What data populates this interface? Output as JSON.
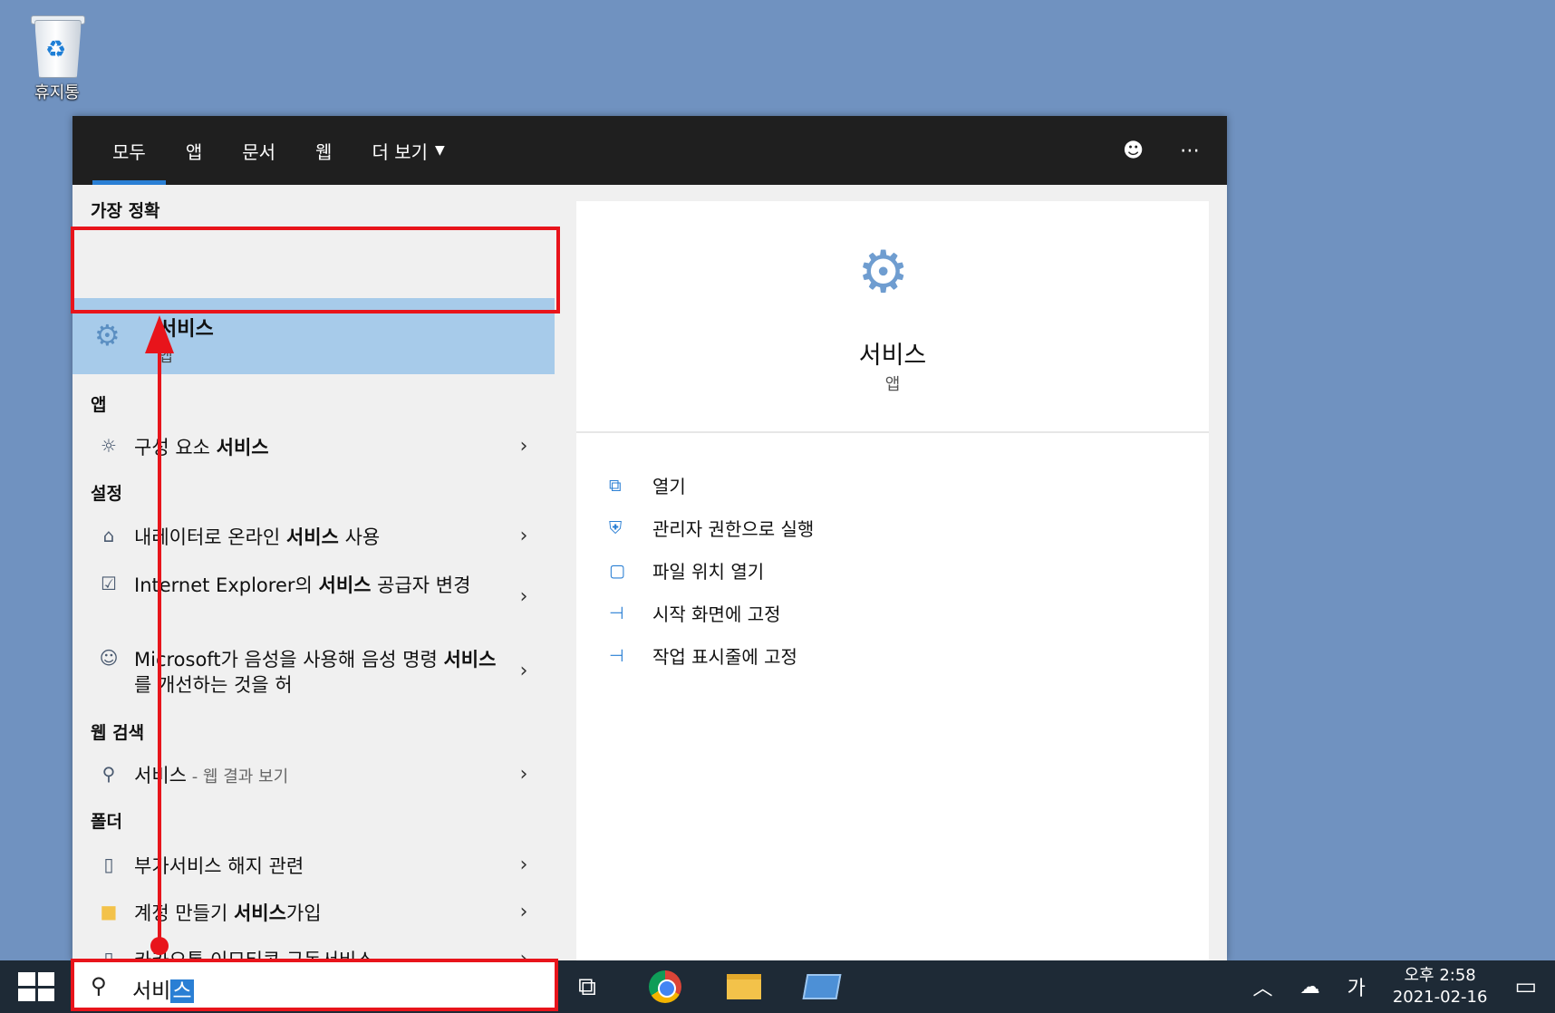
{
  "desktop": {
    "recycle_bin_label": "휴지통"
  },
  "search": {
    "tabs": [
      {
        "label": "모두",
        "active": true
      },
      {
        "label": "앱"
      },
      {
        "label": "문서"
      },
      {
        "label": "웹"
      },
      {
        "label": "더 보기"
      }
    ],
    "sections": {
      "best_match": "가장 정확",
      "apps": "앱",
      "settings": "설정",
      "web": "웹 검색",
      "folders": "폴더"
    },
    "best_match": {
      "title": "서비스",
      "subtitle": "앱"
    },
    "results": {
      "component_services": {
        "pre": "구성 요소 ",
        "bold": "서비스",
        "post": ""
      },
      "narrator": {
        "pre": "내레이터로 온라인 ",
        "bold": "서비스",
        "post": " 사용"
      },
      "ie": {
        "pre": "Internet Explorer의 ",
        "bold": "서비스",
        "post": " 공급자 변경"
      },
      "microsoft_voice": {
        "pre": "Microsoft가 음성을 사용해 음성 명령 ",
        "bold": "서비스",
        "post": "를 개선하는 것을 허"
      },
      "web_search": {
        "pre": "서비스",
        "muted": " - 웹 결과 보기"
      },
      "folder_1": {
        "pre": "부가서비스 해지 관련",
        "bold": "",
        "post": ""
      },
      "folder_2": {
        "pre": "계정 만들기 ",
        "bold": "서비스",
        "post": "가입"
      },
      "folder_3": {
        "pre": "카카오톡 이모티콘 구독서비스",
        "bold": "",
        "post": ""
      }
    },
    "detail": {
      "title": "서비스",
      "subtitle": "앱",
      "actions": [
        "열기",
        "관리자 권한으로 실행",
        "파일 위치 열기",
        "시작 화면에 고정",
        "작업 표시줄에 고정"
      ]
    },
    "query": {
      "typed": "서비",
      "selected": "스"
    }
  },
  "taskbar": {
    "ime": "가",
    "time": "오후 2:58",
    "date": "2021-02-16"
  }
}
